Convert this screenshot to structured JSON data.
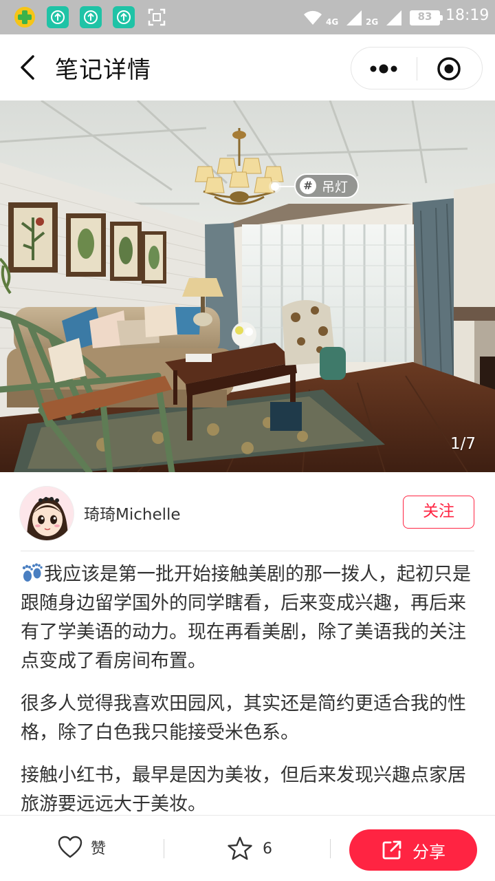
{
  "status_bar": {
    "time": "18:19",
    "battery": "83",
    "net_4g": "4G",
    "net_2g": "2G",
    "icons": [
      "app-badge-icon",
      "upload-icon",
      "upload-icon",
      "upload-icon",
      "scan-icon",
      "wifi-icon",
      "signal-icon",
      "signal-icon",
      "battery-icon"
    ]
  },
  "header": {
    "title": "笔记详情",
    "back_icon": "back-arrow-icon",
    "more_icon": "more-dots-icon",
    "close_icon": "mini-program-close-icon"
  },
  "hero": {
    "tag_label": "吊灯",
    "tag_icon": "#",
    "page_counter": "1/7"
  },
  "author": {
    "name": "琦琦Michelle",
    "follow_label": "关注"
  },
  "content": {
    "paragraphs": [
      "我应该是第一批开始接触美剧的那一拨人，起初只是跟随身边留学国外的同学瞎看，后来变成兴趣，再后来有了学美语的动力。现在再看美剧，除了美语我的关注点变成了看房间布置。",
      "很多人觉得我喜欢田园风，其实还是简约更适合我的性格，除了白色我只能接受米色系。",
      "接触小红书，最早是因为美妆，但后来发现兴趣点家居旅游要远远大于美妆。"
    ]
  },
  "bottom_bar": {
    "like_label": "赞",
    "collect_count": "6",
    "share_label": "分享"
  },
  "colors": {
    "accent": "#ff2442",
    "status_bar_bg": "#bdbdbd",
    "text_primary": "#333333"
  }
}
